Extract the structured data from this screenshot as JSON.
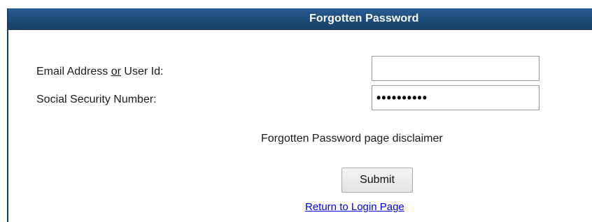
{
  "header": {
    "title": "Forgotten Password"
  },
  "form": {
    "email_label_part1": "Email Address ",
    "email_label_or": "or",
    "email_label_part2": " User Id:",
    "email_value": "",
    "ssn_label": "Social Security Number:",
    "ssn_value": "••••••••••"
  },
  "disclaimer": "Forgotten Password page disclaimer",
  "submit_label": "Submit",
  "return_link": "Return to Login Page",
  "colors": {
    "header_bg": "#1f4d7c",
    "header_text": "#ffffff",
    "link": "#0000ee"
  }
}
